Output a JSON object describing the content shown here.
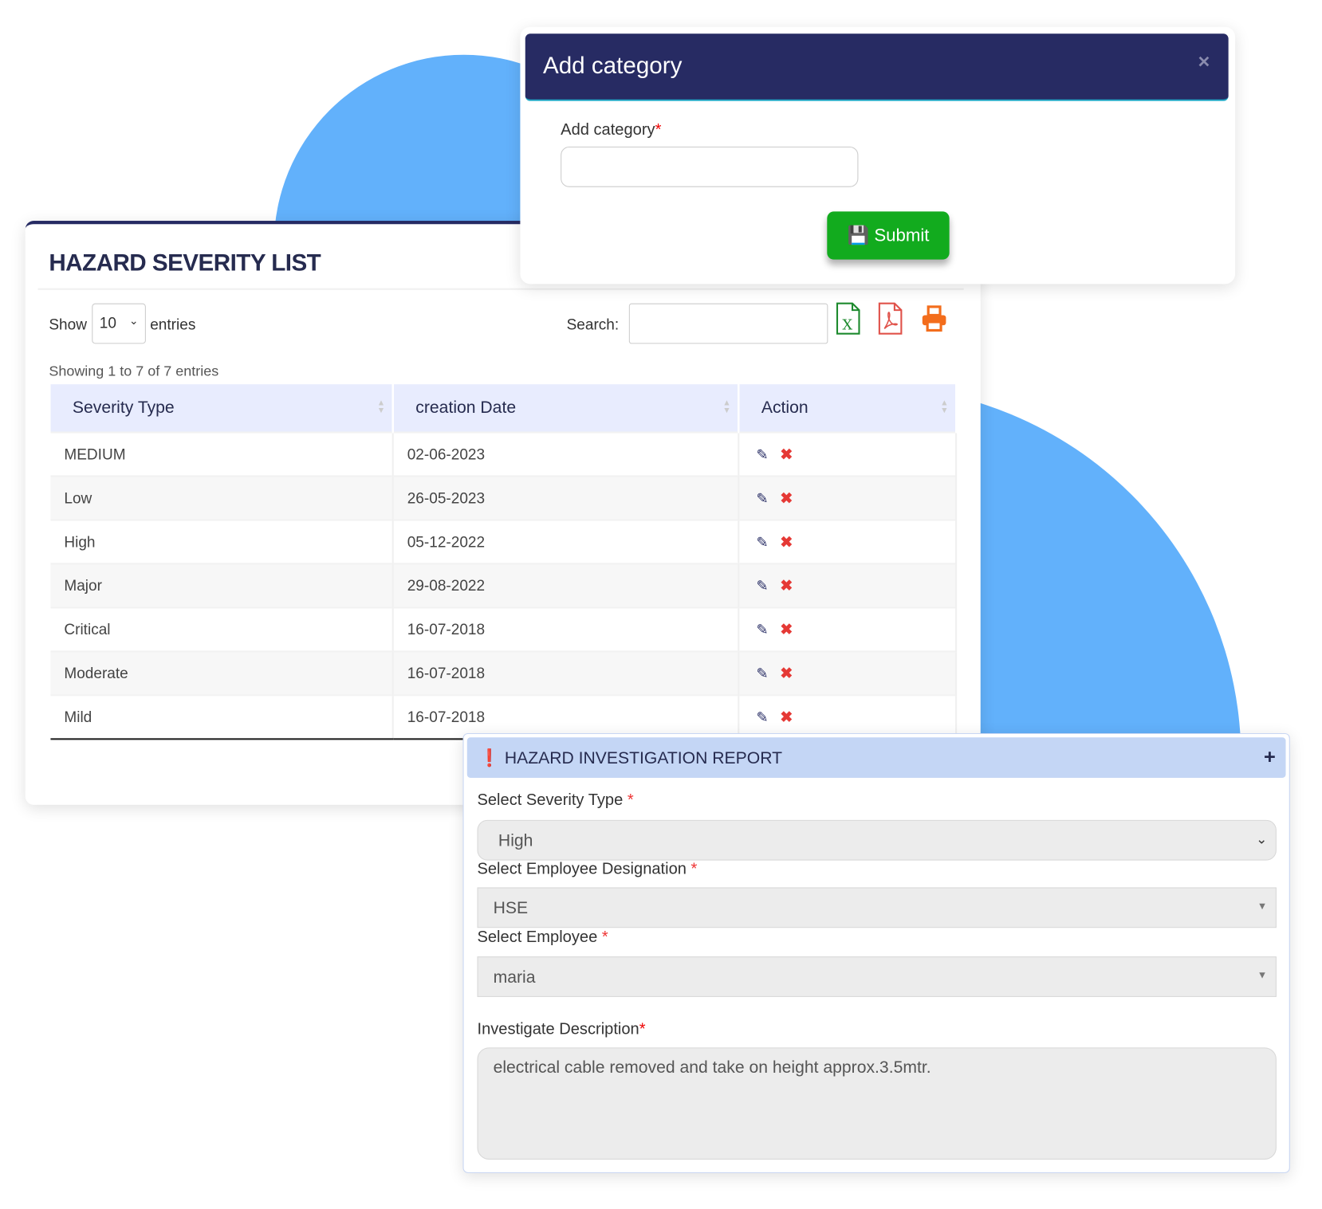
{
  "colors": {
    "navy": "#272b63",
    "accent_blue": "#62b1fb",
    "submit_green": "#12ab1e",
    "header_bg": "#e8ecfe",
    "report_header": "#c4d6f5",
    "delete_red": "#e53935"
  },
  "list": {
    "title": "HAZARD SEVERITY LIST",
    "show_label": "Show",
    "entries_value": "10",
    "entries_label": "entries",
    "search_label": "Search:",
    "search_value": "",
    "export_icons": [
      "excel-icon",
      "pdf-icon",
      "print-icon"
    ],
    "info": "Showing 1 to 7 of 7 entries",
    "columns": [
      "Severity Type",
      "creation Date",
      "Action"
    ],
    "rows": [
      {
        "type": "MEDIUM",
        "date": "02-06-2023"
      },
      {
        "type": "Low",
        "date": "26-05-2023"
      },
      {
        "type": "High",
        "date": "05-12-2022"
      },
      {
        "type": "Major",
        "date": "29-08-2022"
      },
      {
        "type": "Critical",
        "date": "16-07-2018"
      },
      {
        "type": "Moderate",
        "date": "16-07-2018"
      },
      {
        "type": "Mild",
        "date": "16-07-2018"
      }
    ]
  },
  "modal": {
    "title": "Add category",
    "close": "×",
    "field_label": "Add category",
    "required": "*",
    "field_value": "",
    "submit_label": "Submit"
  },
  "report": {
    "title": "HAZARD INVESTIGATION REPORT",
    "expand": "+",
    "severity_label": "Select Severity Type",
    "severity_value": "High",
    "designation_label": "Select Employee Designation",
    "designation_value": "HSE",
    "employee_label": "Select Employee",
    "employee_value": "maria",
    "description_label": "Investigate Description",
    "description_value": "electrical cable removed and take on height approx.3.5mtr.",
    "required": "*"
  }
}
